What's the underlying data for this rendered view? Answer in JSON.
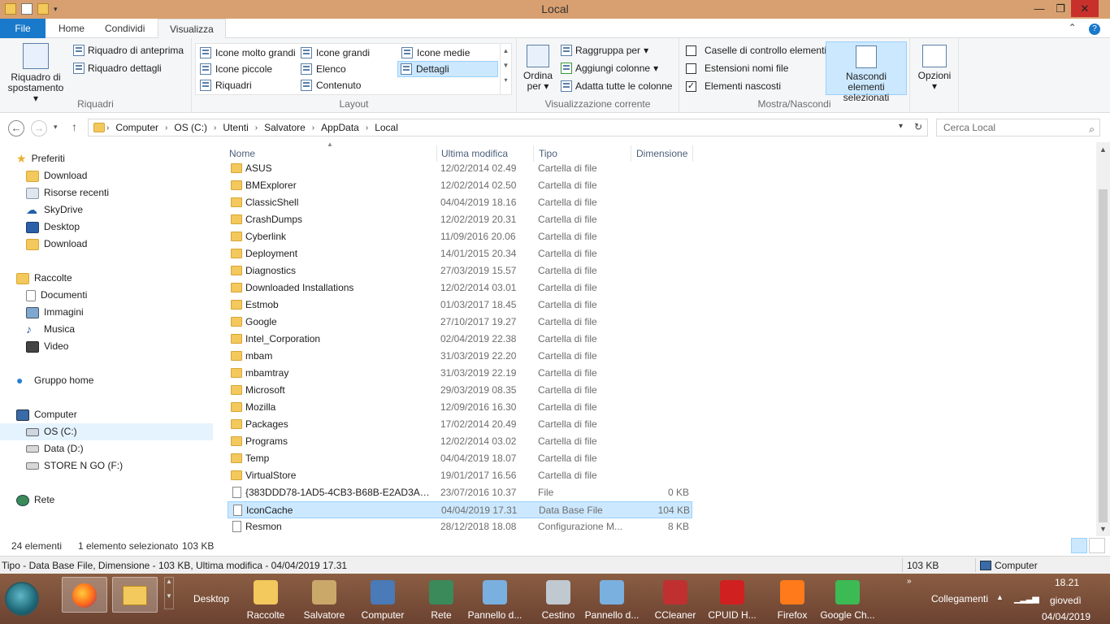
{
  "window": {
    "title": "Local",
    "min_glyph": "—",
    "max_glyph": "❐",
    "close_glyph": "✕"
  },
  "ribbon_tabs": {
    "file": "File",
    "home": "Home",
    "share": "Condividi",
    "view": "Visualizza"
  },
  "ribbon": {
    "panes": {
      "navigation_pane": "Riquadro di spostamento",
      "preview_pane": "Riquadro di anteprima",
      "details_pane": "Riquadro dettagli",
      "group_label": "Riquadri"
    },
    "layout": {
      "items": [
        "Icone molto grandi",
        "Icone grandi",
        "Icone medie",
        "Icone piccole",
        "Elenco",
        "Dettagli",
        "Riquadri",
        "Contenuto"
      ],
      "selected": "Dettagli",
      "group_label": "Layout"
    },
    "current_view": {
      "sort_by": "Ordina per",
      "group_by": "Raggruppa per",
      "add_columns": "Aggiungi colonne",
      "fit_columns": "Adatta tutte le colonne",
      "group_label": "Visualizzazione corrente"
    },
    "show_hide": {
      "item_checkboxes": "Caselle di controllo elementi",
      "file_extensions": "Estensioni nomi file",
      "hidden_items": "Elementi nascosti",
      "item_checkboxes_checked": false,
      "file_extensions_checked": false,
      "hidden_items_checked": true,
      "hide_selected": "Nascondi elementi selezionati",
      "group_label": "Mostra/Nascondi"
    },
    "options": "Opzioni"
  },
  "address": {
    "crumbs": [
      "Computer",
      "OS (C:)",
      "Utenti",
      "Salvatore",
      "AppData",
      "Local"
    ],
    "search_placeholder": "Cerca Local"
  },
  "nav": {
    "favorites_header": "Preferiti",
    "favorites": [
      "Download",
      "Risorse recenti",
      "SkyDrive",
      "Desktop",
      "Download"
    ],
    "libraries_header": "Raccolte",
    "libraries": [
      "Documenti",
      "Immagini",
      "Musica",
      "Video"
    ],
    "homegroup": "Gruppo home",
    "computer_header": "Computer",
    "drives": [
      "OS (C:)",
      "Data (D:)",
      "STORE N GO (F:)"
    ],
    "selected_drive": "OS (C:)",
    "network": "Rete"
  },
  "columns": {
    "name": "Nome",
    "modified": "Ultima modifica",
    "type": "Tipo",
    "size": "Dimensione"
  },
  "files": [
    {
      "name": "ASUS",
      "date": "12/02/2014 02.49",
      "type": "Cartella di file",
      "size": "",
      "kind": "folder"
    },
    {
      "name": "BMExplorer",
      "date": "12/02/2014 02.50",
      "type": "Cartella di file",
      "size": "",
      "kind": "folder"
    },
    {
      "name": "ClassicShell",
      "date": "04/04/2019 18.16",
      "type": "Cartella di file",
      "size": "",
      "kind": "folder"
    },
    {
      "name": "CrashDumps",
      "date": "12/02/2019 20.31",
      "type": "Cartella di file",
      "size": "",
      "kind": "folder"
    },
    {
      "name": "Cyberlink",
      "date": "11/09/2016 20.06",
      "type": "Cartella di file",
      "size": "",
      "kind": "folder"
    },
    {
      "name": "Deployment",
      "date": "14/01/2015 20.34",
      "type": "Cartella di file",
      "size": "",
      "kind": "folder"
    },
    {
      "name": "Diagnostics",
      "date": "27/03/2019 15.57",
      "type": "Cartella di file",
      "size": "",
      "kind": "folder"
    },
    {
      "name": "Downloaded Installations",
      "date": "12/02/2014 03.01",
      "type": "Cartella di file",
      "size": "",
      "kind": "folder"
    },
    {
      "name": "Estmob",
      "date": "01/03/2017 18.45",
      "type": "Cartella di file",
      "size": "",
      "kind": "folder"
    },
    {
      "name": "Google",
      "date": "27/10/2017 19.27",
      "type": "Cartella di file",
      "size": "",
      "kind": "folder"
    },
    {
      "name": "Intel_Corporation",
      "date": "02/04/2019 22.38",
      "type": "Cartella di file",
      "size": "",
      "kind": "folder"
    },
    {
      "name": "mbam",
      "date": "31/03/2019 22.20",
      "type": "Cartella di file",
      "size": "",
      "kind": "folder"
    },
    {
      "name": "mbamtray",
      "date": "31/03/2019 22.19",
      "type": "Cartella di file",
      "size": "",
      "kind": "folder"
    },
    {
      "name": "Microsoft",
      "date": "29/03/2019 08.35",
      "type": "Cartella di file",
      "size": "",
      "kind": "folder"
    },
    {
      "name": "Mozilla",
      "date": "12/09/2016 16.30",
      "type": "Cartella di file",
      "size": "",
      "kind": "folder"
    },
    {
      "name": "Packages",
      "date": "17/02/2014 20.49",
      "type": "Cartella di file",
      "size": "",
      "kind": "folder"
    },
    {
      "name": "Programs",
      "date": "12/02/2014 03.02",
      "type": "Cartella di file",
      "size": "",
      "kind": "folder"
    },
    {
      "name": "Temp",
      "date": "04/04/2019 18.07",
      "type": "Cartella di file",
      "size": "",
      "kind": "folder"
    },
    {
      "name": "VirtualStore",
      "date": "19/01/2017 16.56",
      "type": "Cartella di file",
      "size": "",
      "kind": "folder"
    },
    {
      "name": "{383DDD78-1AD5-4CB3-B68B-E2AD3ADC...",
      "date": "23/07/2016 10.37",
      "type": "File",
      "size": "0 KB",
      "kind": "file"
    },
    {
      "name": "IconCache",
      "date": "04/04/2019 17.31",
      "type": "Data Base File",
      "size": "104 KB",
      "kind": "file",
      "selected": true
    },
    {
      "name": "Resmon",
      "date": "28/12/2018 18.08",
      "type": "Configurazione M...",
      "size": "8 KB",
      "kind": "file"
    }
  ],
  "status": {
    "count": "24 elementi",
    "selection": "1 elemento selezionato",
    "selection_size": "103 KB"
  },
  "details": {
    "summary": "Tipo - Data Base File, Dimensione - 103 KB, Ultima modifica - 04/04/2019 17.31",
    "size": "103 KB",
    "location": "Computer"
  },
  "taskbar": {
    "desktop_label": "Desktop",
    "items": [
      "Raccolte",
      "Salvatore",
      "Computer",
      "Rete",
      "Pannello d...",
      "Cestino",
      "Pannello d...",
      "CCleaner",
      "CPUID H...",
      "Firefox",
      "Google Ch..."
    ],
    "links": "Collegamenti",
    "time": "18.21",
    "day": "giovedì",
    "date": "04/04/2019"
  },
  "colors": {
    "titlebar": "#d8a070",
    "file_tab": "#1979ca",
    "selection": "#cce8ff",
    "close": "#c7302b",
    "taskbar": "#7a4e3a"
  }
}
